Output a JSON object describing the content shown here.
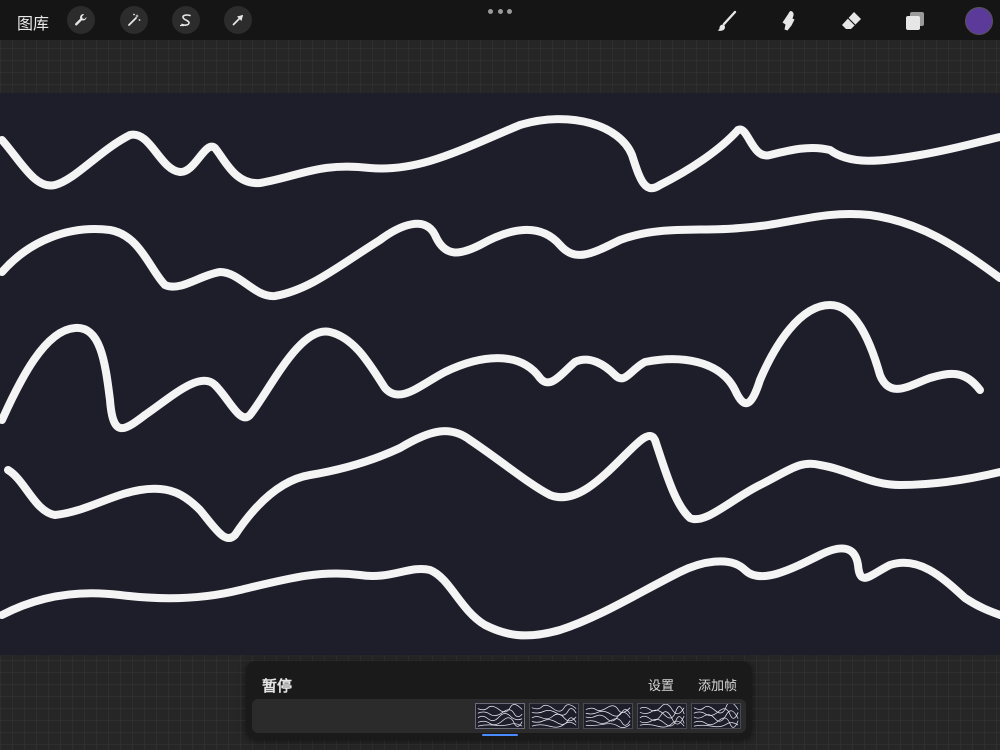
{
  "topbar": {
    "gallery_label": "图库",
    "tools_left": [
      "wrench-icon",
      "magic-wand-icon",
      "selection-s-icon",
      "transform-arrow-icon"
    ],
    "tools_right": [
      "brush-icon",
      "smudge-icon",
      "eraser-icon",
      "layers-icon"
    ],
    "current_color": "#5b3a9a"
  },
  "animation": {
    "pause_label": "暂停",
    "settings_label": "设置",
    "add_frame_label": "添加帧",
    "frame_count": 5,
    "indicator_color": "#4a8cff"
  },
  "canvas": {
    "background": "#1e1d2a",
    "stroke_color": "#f4f4f4"
  }
}
